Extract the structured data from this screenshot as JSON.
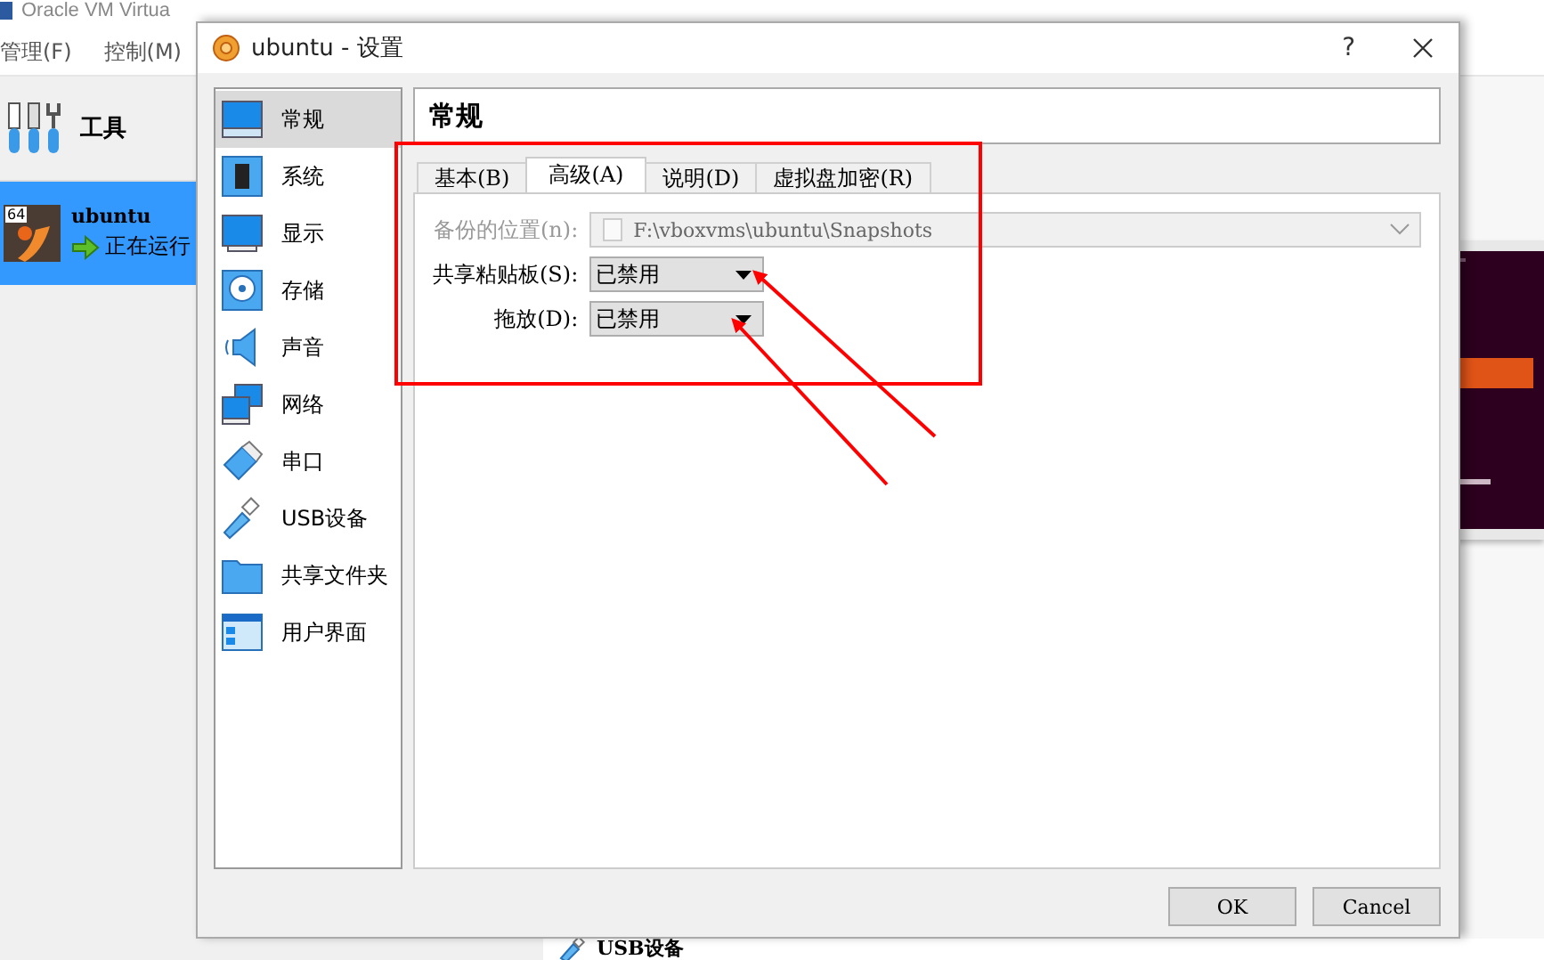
{
  "main_window": {
    "title": "Oracle VM Virtua",
    "menu": [
      "管理(F)",
      "控制(M)"
    ],
    "tools_label": "工具",
    "vms": [
      {
        "name": "ubuntu",
        "arch": "64",
        "status": "正在运行",
        "selected": true
      }
    ],
    "details_section": "USB设备"
  },
  "dialog": {
    "title": "ubuntu - 设置",
    "help_button": "?",
    "categories": [
      {
        "label": "常规",
        "selected": true
      },
      {
        "label": "系统",
        "selected": false
      },
      {
        "label": "显示",
        "selected": false
      },
      {
        "label": "存储",
        "selected": false
      },
      {
        "label": "声音",
        "selected": false
      },
      {
        "label": "网络",
        "selected": false
      },
      {
        "label": "串口",
        "selected": false
      },
      {
        "label": "USB设备",
        "selected": false
      },
      {
        "label": "共享文件夹",
        "selected": false
      },
      {
        "label": "用户界面",
        "selected": false
      }
    ],
    "page_title": "常规",
    "tabs": [
      {
        "label": "基本(B)",
        "selected": false
      },
      {
        "label": "高级(A)",
        "selected": true
      },
      {
        "label": "说明(D)",
        "selected": false
      },
      {
        "label": "虚拟盘加密(R)",
        "selected": false
      }
    ],
    "fields": [
      {
        "label": "备份的位置(n):",
        "kind": "path",
        "value": "F:\\vboxvms\\ubuntu\\Snapshots",
        "disabled": true
      },
      {
        "label": "共享粘贴板(S):",
        "kind": "combo",
        "value": "已禁用",
        "disabled": false
      },
      {
        "label": "拖放(D):",
        "kind": "combo",
        "value": "已禁用",
        "disabled": false
      }
    ],
    "buttons": [
      "OK",
      "Cancel"
    ]
  }
}
